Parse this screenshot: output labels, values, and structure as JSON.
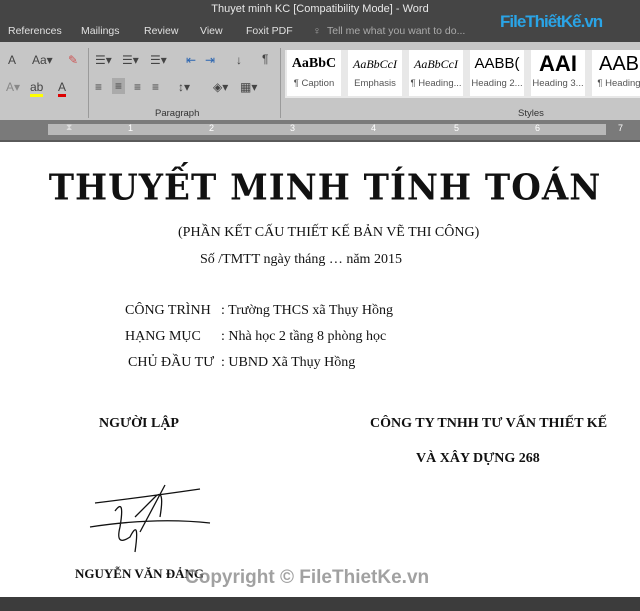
{
  "window": {
    "title": "Thuyet minh KC [Compatibility Mode] - Word"
  },
  "tabs": [
    "References",
    "Mailings",
    "Review",
    "View",
    "Foxit PDF"
  ],
  "tell_me": "Tell me what you want to do...",
  "logo": "FileThiếtKế.vn",
  "ribbon": {
    "groups": {
      "paragraph": "Paragraph",
      "styles": "Styles"
    },
    "styles": [
      {
        "preview": "AaBbC",
        "name": "¶ Caption"
      },
      {
        "preview": "AaBbCcI",
        "name": "Emphasis"
      },
      {
        "preview": "AaBbCcI",
        "name": "¶ Heading..."
      },
      {
        "preview": "AABB(",
        "name": "Heading 2..."
      },
      {
        "preview": "AAI",
        "name": "Heading 3..."
      },
      {
        "preview": "AAB",
        "name": "¶ Heading"
      }
    ]
  },
  "ruler": [
    "1",
    "2",
    "3",
    "4",
    "5",
    "6",
    "7"
  ],
  "document": {
    "title": "THUYẾT MINH TÍNH TOÁN",
    "subtitle": "(PHẦN KẾT CẤU THIẾT KẾ BẢN VẼ THI CÔNG)",
    "number_line": "Số  /TMTT ngày     tháng … năm 2015",
    "fields": [
      {
        "label": "CÔNG  TRÌNH",
        "value": ": Trường THCS xã Thụy Hồng"
      },
      {
        "label": "HẠNG MỤC",
        "value": ":  Nhà học 2 tầng 8 phòng học"
      },
      {
        "label": "CHỦ ĐẦU TƯ",
        "value": ": UBND Xã Thụy Hồng"
      }
    ],
    "preparer_label": "NGƯỜI LẬP",
    "company_line1": "CÔNG TY TNHH TƯ VẤN THIẾT KẾ",
    "company_line2": "VÀ XÂY DỰNG 268",
    "preparer_name": "NGUYỄN VĂN ĐẢNG"
  },
  "watermark": "Copyright © FileThietKe.vn"
}
